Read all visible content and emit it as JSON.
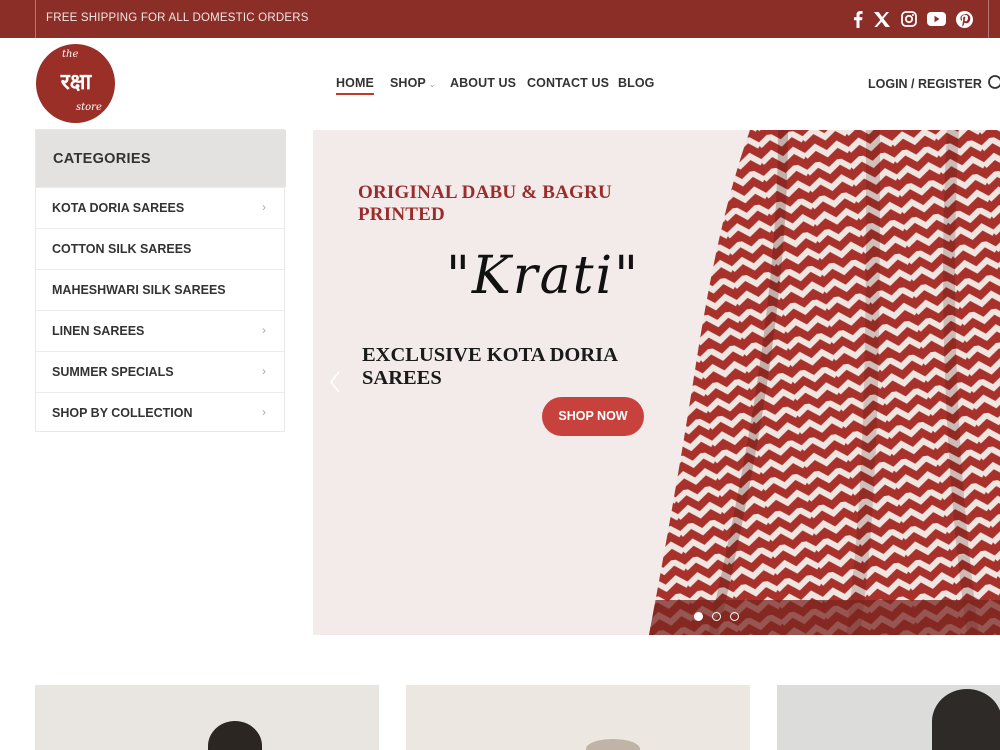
{
  "topbar": {
    "shipping_text": "FREE SHIPPING FOR ALL DOMESTIC ORDERS",
    "social_icons": [
      "facebook-icon",
      "x-icon",
      "instagram-icon",
      "youtube-icon",
      "pinterest-icon"
    ]
  },
  "header": {
    "logo_text": "रक्षा",
    "logo_script_top": "the",
    "logo_script_bottom": "store",
    "nav": [
      {
        "label": "HOME"
      },
      {
        "label": "SHOP"
      },
      {
        "label": "ABOUT US"
      },
      {
        "label": "CONTACT US"
      },
      {
        "label": "BLOG"
      }
    ],
    "login_label": "LOGIN / REGISTER"
  },
  "sidebar": {
    "title": "CATEGORIES",
    "items": [
      {
        "label": "KOTA DORIA SAREES"
      },
      {
        "label": "COTTON SILK SAREES"
      },
      {
        "label": "MAHESHWARI SILK SAREES"
      },
      {
        "label": "LINEN SAREES"
      },
      {
        "label": "SUMMER SPECIALS"
      },
      {
        "label": "SHOP BY COLLECTION"
      }
    ]
  },
  "hero": {
    "heading": "ORIGINAL DABU & BAGRU PRINTED",
    "script_title": "\"Krati\"",
    "subheading": "EXCLUSIVE KOTA DORIA SAREES",
    "cta_label": "SHOP NOW",
    "slide_count": 3,
    "active_slide": 1
  },
  "colors": {
    "brand": "#8b2e28",
    "accent": "#c8423d",
    "hero_bg": "#f2ebe9"
  }
}
